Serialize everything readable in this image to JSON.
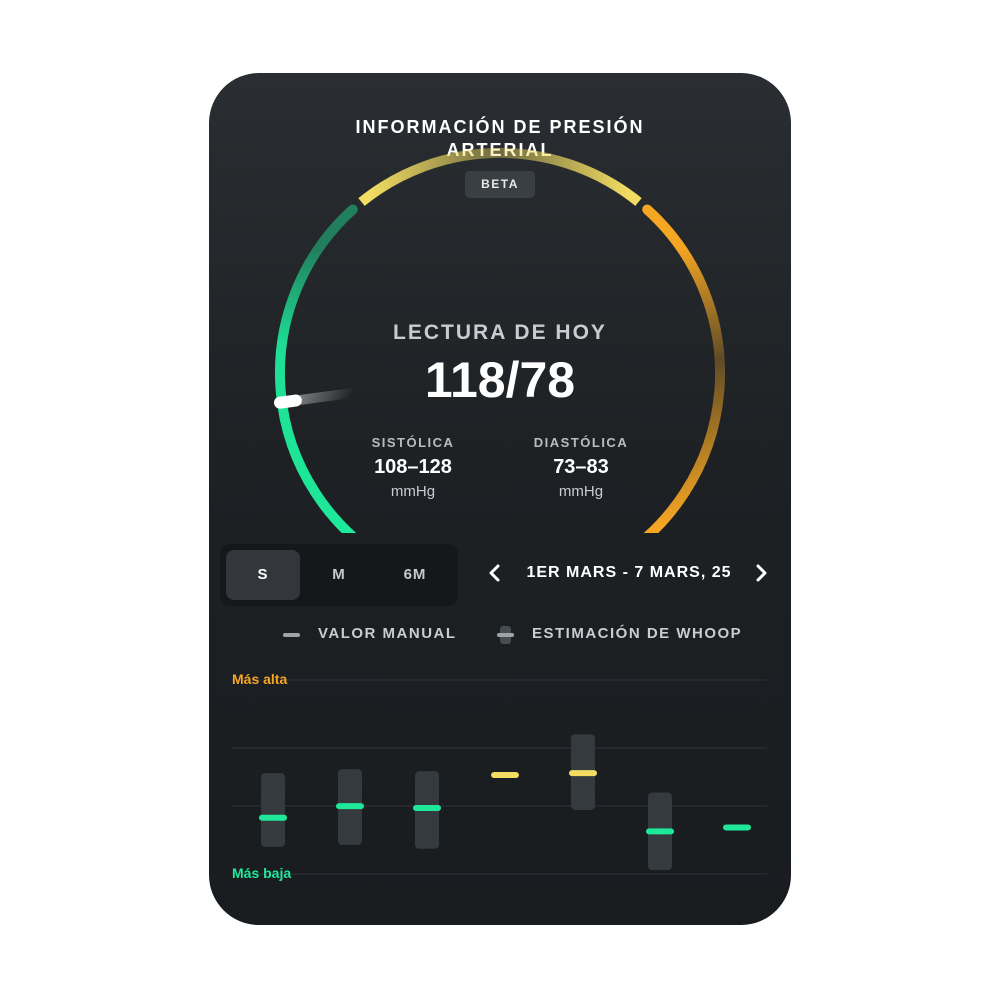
{
  "header": {
    "title_line1": "INFORMACIÓN DE PRESIÓN",
    "title_line2": "ARTERIAL",
    "badge": "BETA"
  },
  "gauge": {
    "reading_label": "LECTURA DE HOY",
    "reading_value": "118/78",
    "indicator_fraction": 0.17,
    "zone_colors": {
      "low": "#1ee89a",
      "normal": "#f2dd62",
      "high": "#f5a623"
    },
    "systolic": {
      "label": "SISTÓLICA",
      "range": "108–128",
      "unit": "mmHg"
    },
    "diastolic": {
      "label": "DIASTÓLICA",
      "range": "73–83",
      "unit": "mmHg"
    }
  },
  "period_selector": {
    "options": [
      "S",
      "M",
      "6M"
    ],
    "selected": "S"
  },
  "date_range": {
    "text": "1ER MARS - 7 MARS, 25",
    "prev_icon": "chevron-left-icon",
    "next_icon": "chevron-right-icon"
  },
  "legend": {
    "manual": "VALOR MANUAL",
    "whoop": "ESTIMACIÓN DE WHOOP"
  },
  "chart_data": {
    "type": "scatter",
    "y_top_label": "Más alta",
    "y_bottom_label": "Más baja",
    "y_top_color": "#f5a623",
    "y_bottom_color": "#1ee89a",
    "ylim": [
      0,
      1
    ],
    "grid": true,
    "days": [
      {
        "value": 0.29,
        "range": [
          0.14,
          0.52
        ],
        "color": "#1ee89a"
      },
      {
        "value": 0.35,
        "range": [
          0.15,
          0.54
        ],
        "color": "#1ee89a"
      },
      {
        "value": 0.34,
        "range": [
          0.13,
          0.53
        ],
        "color": "#1ee89a"
      },
      {
        "value": 0.51,
        "range": null,
        "color": "#f2dd62"
      },
      {
        "value": 0.52,
        "range": [
          0.33,
          0.72
        ],
        "color": "#f2dd62"
      },
      {
        "value": 0.22,
        "range": [
          0.02,
          0.42
        ],
        "color": "#1ee89a"
      },
      {
        "value": 0.24,
        "range": null,
        "color": "#1ee89a"
      }
    ]
  }
}
